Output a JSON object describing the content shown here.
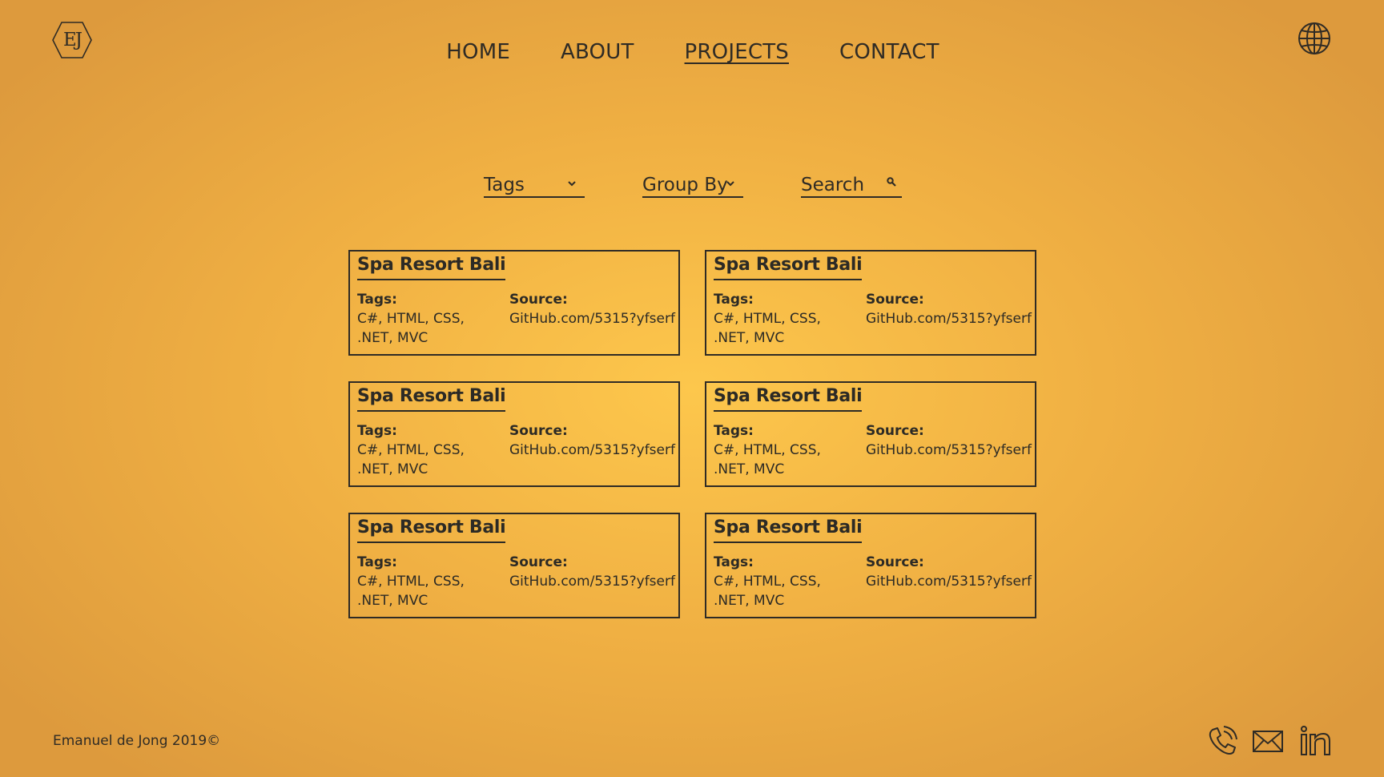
{
  "logo": {
    "text": "EJ"
  },
  "nav": {
    "items": [
      {
        "label": "HOME",
        "active": false
      },
      {
        "label": "ABOUT",
        "active": false
      },
      {
        "label": "PROJECTS",
        "active": true
      },
      {
        "label": "CONTACT",
        "active": false
      }
    ]
  },
  "header": {
    "language_icon": "globe-icon"
  },
  "filters": {
    "tags_label": "Tags",
    "group_by_label": "Group By",
    "search_placeholder": "Search",
    "dropdown_icon": "chevron-down-icon",
    "search_icon": "search-icon"
  },
  "projects": [
    {
      "title": "Spa Resort Bali",
      "tags_label": "Tags:",
      "tags": "C#, HTML, CSS, .NET, MVC",
      "source_label": "Source:",
      "source": "GitHub.com/5315?yfserf"
    },
    {
      "title": "Spa Resort Bali",
      "tags_label": "Tags:",
      "tags": "C#, HTML, CSS, .NET, MVC",
      "source_label": "Source:",
      "source": "GitHub.com/5315?yfserf"
    },
    {
      "title": "Spa Resort Bali",
      "tags_label": "Tags:",
      "tags": "C#, HTML, CSS, .NET, MVC",
      "source_label": "Source:",
      "source": "GitHub.com/5315?yfserf"
    },
    {
      "title": "Spa Resort Bali",
      "tags_label": "Tags:",
      "tags": "C#, HTML, CSS, .NET, MVC",
      "source_label": "Source:",
      "source": "GitHub.com/5315?yfserf"
    },
    {
      "title": "Spa Resort Bali",
      "tags_label": "Tags:",
      "tags": "C#, HTML, CSS, .NET, MVC",
      "source_label": "Source:",
      "source": "GitHub.com/5315?yfserf"
    },
    {
      "title": "Spa Resort Bali",
      "tags_label": "Tags:",
      "tags": "C#, HTML, CSS, .NET, MVC",
      "source_label": "Source:",
      "source": "GitHub.com/5315?yfserf"
    }
  ],
  "footer": {
    "copyright": "Emanuel de Jong 2019©",
    "icons": [
      "phone-icon",
      "mail-icon",
      "linkedin-icon"
    ]
  },
  "colors": {
    "background_center": "#fdc74c",
    "background_edge": "#dd9a3d",
    "ink": "#2c2a25"
  }
}
